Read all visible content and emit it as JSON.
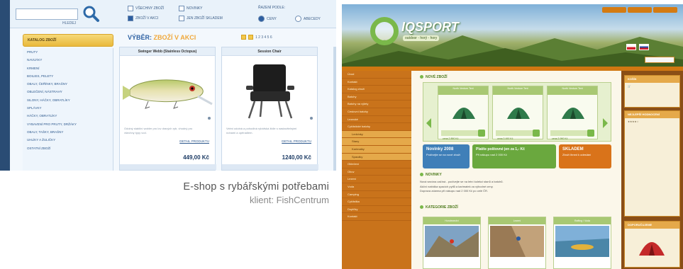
{
  "caption": {
    "title": "E-shop s rybářskými potřebami",
    "client": "klient: FishCentrum"
  },
  "shop": {
    "search_button": "HLEDEJ",
    "filters": [
      {
        "label": "VŠECHNY ZBOŽÍ",
        "checked": false
      },
      {
        "label": "NOVINKY",
        "checked": false
      },
      {
        "label": "ZBOŽÍ V AKCI",
        "checked": true
      },
      {
        "label": "JEN ZBOŽÍ SKLADEM",
        "checked": false
      }
    ],
    "sort_label": "ŘAZENÍ PODLE:",
    "sort_options": [
      {
        "label": "CENY",
        "selected": true
      },
      {
        "label": "ABECEDY",
        "selected": false
      }
    ],
    "category_heading": "KATALOG ZBOŽÍ",
    "categories": [
      "PRUTY",
      "NAVIJÁKY",
      "KRMENÍ",
      "BOILIES, PELETY",
      "OBALY, ČEŘÍNKY, BRAŠNY",
      "OBLEČENÍ, NÁSTRAHY",
      "SILONY, HÁČKY, OBRATLÍKY",
      "SPLÁVKY",
      "HÁČKY, OBRATLÍKY",
      "VYBAVENÍ PRO PRUTY, DRŽÁKY",
      "OBALY, TAŠKY, BRAŠNY",
      "UHLÍKY A ŽULIČKY",
      "OSTATNÍ ZBOŽÍ"
    ],
    "pick_title_prefix": "VÝBĚR:",
    "pick_title_highlight": "ZBOŽÍ V AKCI",
    "pager": "1 2 3 4 5 6",
    "products": [
      {
        "name": "Swinger Webb (Stainless Octopus)",
        "description": "Odolný stabilní wobler pro lov dravých ryb, vhodný pro všechny typy vod.",
        "link": "DETAIL PRODUKTU",
        "price": "449,00 Kč"
      },
      {
        "name": "Session Chair",
        "description": "Velmi odolná a pohodlná rybářská židle s nastavitelnými nohami a opěradlem.",
        "link": "DETAIL PRODUKTU",
        "price": "1240,00 Kč"
      }
    ]
  },
  "outdoor": {
    "logo": "IQSPORT",
    "logo_sub": "outdoor - horý - hory",
    "sidebar": [
      "Úvod",
      "Kontakt",
      "Katalog zboží",
      "Batohy",
      "Batohy na výlety",
      "Cestovní batohy",
      "Lezecké",
      "Cyklistické batohy",
      "Ledvinky",
      "Stany",
      "Karimatky",
      "Spacáky",
      "Oblečení",
      "Obuv",
      "Lezení",
      "Voda",
      "Camping",
      "Cyklistika",
      "Doplňky",
      "Kontakt"
    ],
    "section_new": "NOVÉ ZBOŽÍ",
    "section_news": "NOVINKY",
    "section_categories": "KATEGORIE ZBOŽÍ",
    "new_products": [
      {
        "name": "North Venture Tent",
        "price": "cena 2 890 Kč"
      },
      {
        "name": "North Venture Tent",
        "price": "cena 3 490 Kč"
      },
      {
        "name": "North Venture Tent",
        "price": "cena 3 990 Kč"
      }
    ],
    "banners": [
      {
        "title": "Novinky 2008",
        "sub": "Podívejte se na nové zboží"
      },
      {
        "title": "Platíte poštovné jen za 1,- Kč",
        "sub": "Při nákupu nad 2 000 Kč"
      },
      {
        "title": "SKLADEM",
        "sub": "Zboží ihned k odeslání"
      }
    ],
    "news": [
      "Nová sezóna začíná - podívejte se na letní kolekci stanů a batohů.",
      "Akční nabídka spacích pytlů a karimatek za výhodné ceny.",
      "Doprava zdarma při nákupu nad 2 000 Kč po celé ČR."
    ],
    "categories": [
      "Horolezectví",
      "Lezení",
      "Rafting / Voda"
    ],
    "right_boxes": [
      "KOŠÍK",
      "NEJLEPŠÍ HODNOCENÍ",
      "DOPORUČUJEME"
    ]
  }
}
